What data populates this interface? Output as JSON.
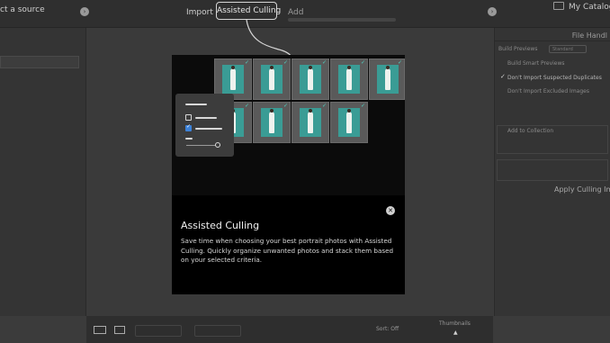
{
  "topbar": {
    "source_label": "ct a source",
    "tabs": {
      "import": "Import",
      "assisted_culling": "Assisted Culling",
      "add": "Add"
    },
    "catalog_label": "My Catalog"
  },
  "right_panel": {
    "title": "File Handl",
    "rows": {
      "build_previews": "Build Previews",
      "build_previews_value": "Standard",
      "build_smart_previews": "Build Smart Previews",
      "dont_import_duplicates": "Don't Import Suspected Duplicates",
      "dont_import_excluded": "Don't Import Excluded Images",
      "add_to_collection": "Add to Collection"
    },
    "apply_label": "Apply Culling Impo"
  },
  "bottombar": {
    "sort_label": "Sort: Off",
    "thumbnails_label": "Thumbnails"
  },
  "modal": {
    "title": "Assisted Culling",
    "body": "Save time when choosing your best portrait photos with Assisted Culling. Quickly organize unwanted photos and stack them based on your selected criteria.",
    "close_glyph": "✕",
    "check_glyph": "✓"
  },
  "icons": {
    "nav_left": "arrow-right-circle-icon",
    "nav_right": "arrow-right-circle-icon",
    "catalog": "catalog-icon",
    "close": "close-icon"
  },
  "colors": {
    "photo_backdrop": "#3a9c95",
    "checkbox_selected": "#3d82d8",
    "modal_background": "#000000"
  }
}
